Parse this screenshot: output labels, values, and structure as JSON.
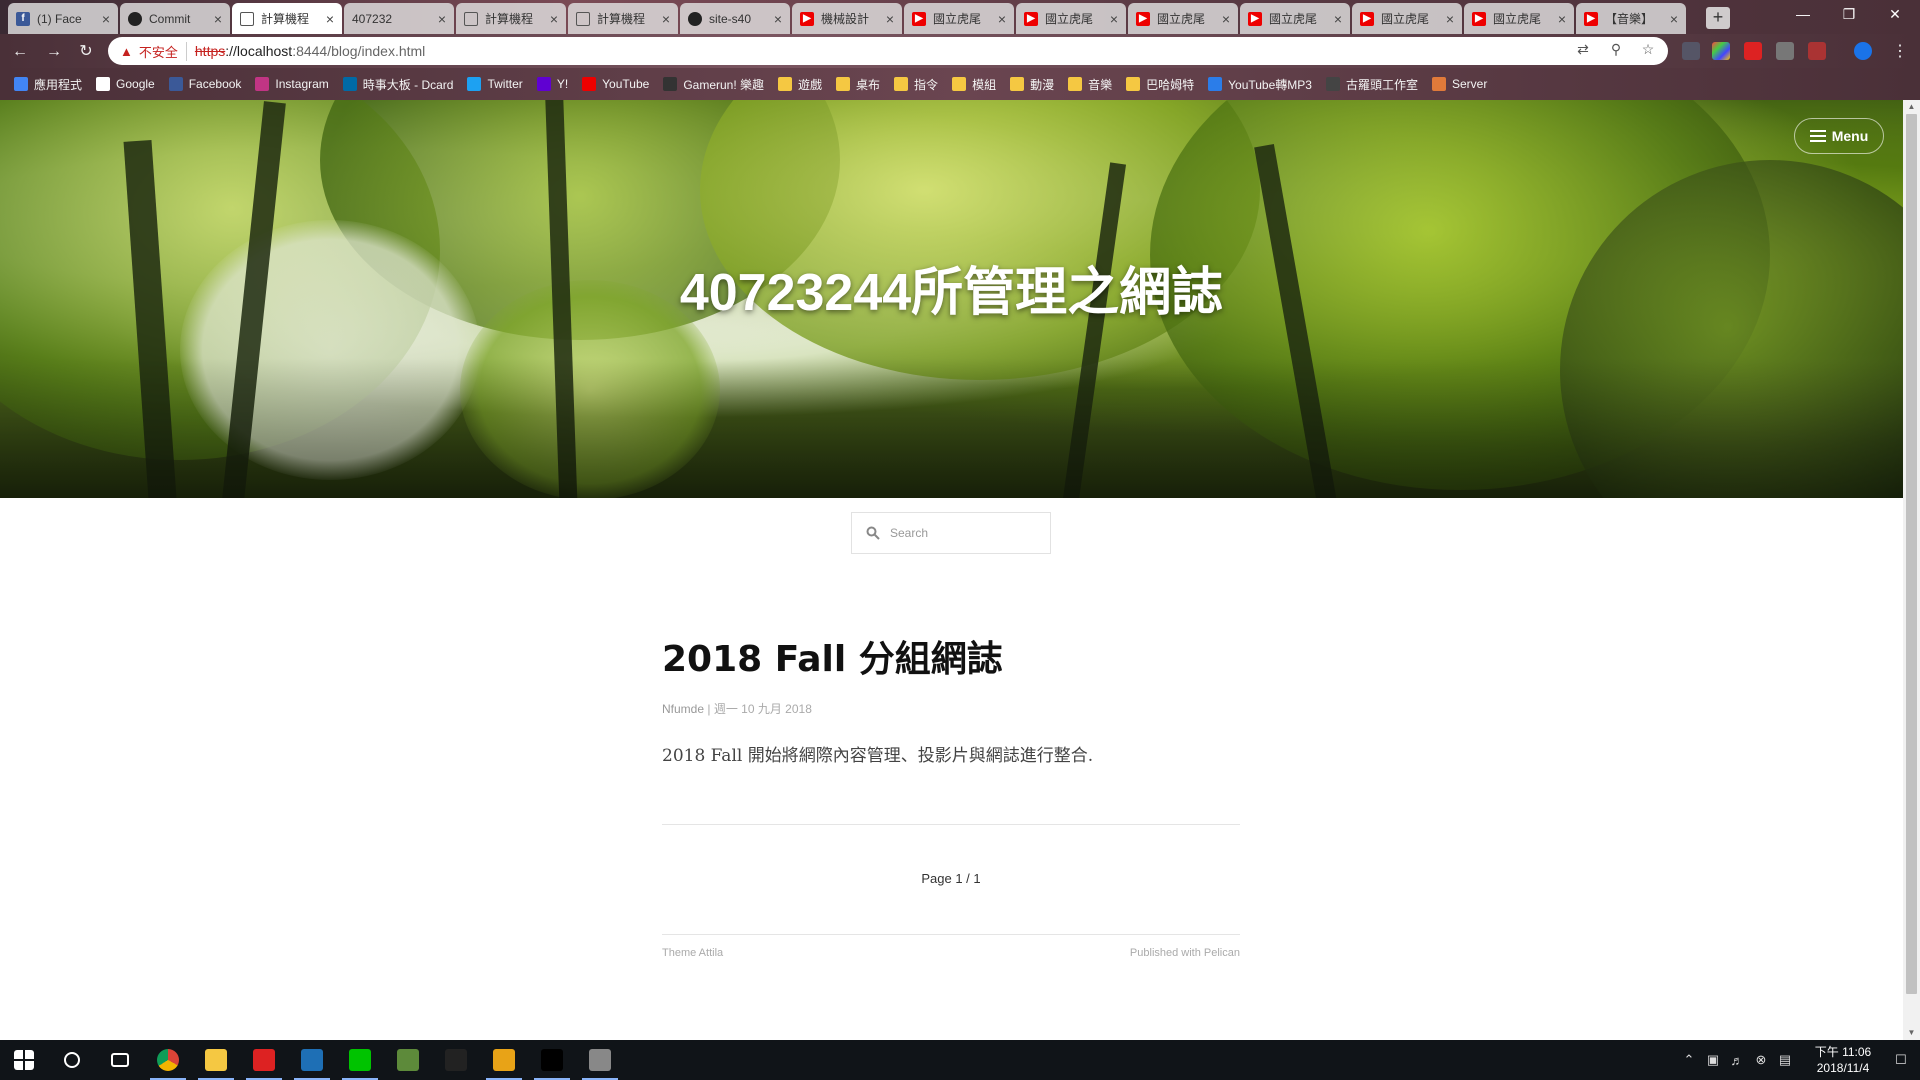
{
  "browser": {
    "tabs": [
      {
        "title": "(1) Face",
        "icon": "facebook-icon",
        "active": false
      },
      {
        "title": "Commit",
        "icon": "github-icon",
        "active": false
      },
      {
        "title": "計算機程",
        "icon": "document-icon",
        "active": true
      },
      {
        "title": "407232",
        "icon": "none",
        "active": false
      },
      {
        "title": "計算機程",
        "icon": "document-icon",
        "active": false
      },
      {
        "title": "計算機程",
        "icon": "document-icon",
        "active": false
      },
      {
        "title": "site-s40",
        "icon": "github-icon",
        "active": false
      },
      {
        "title": "機械設計",
        "icon": "youtube-icon",
        "active": false
      },
      {
        "title": "國立虎尾",
        "icon": "youtube-icon",
        "active": false
      },
      {
        "title": "國立虎尾",
        "icon": "youtube-icon",
        "active": false
      },
      {
        "title": "國立虎尾",
        "icon": "youtube-icon",
        "active": false
      },
      {
        "title": "國立虎尾",
        "icon": "youtube-icon",
        "active": false
      },
      {
        "title": "國立虎尾",
        "icon": "youtube-icon",
        "active": false
      },
      {
        "title": "國立虎尾",
        "icon": "youtube-icon",
        "active": false
      },
      {
        "title": "【音樂】",
        "icon": "youtube-icon",
        "active": false
      }
    ],
    "security_label": "不安全",
    "url_scheme": "https",
    "url_host": "://localhost",
    "url_rest": ":8444/blog/index.html",
    "bookmarks": [
      {
        "label": "應用程式",
        "icon": "apps-icon"
      },
      {
        "label": "Google",
        "icon": "google-icon"
      },
      {
        "label": "Facebook",
        "icon": "facebook-icon"
      },
      {
        "label": "Instagram",
        "icon": "instagram-icon"
      },
      {
        "label": "時事大板 - Dcard",
        "icon": "dcard-icon"
      },
      {
        "label": "Twitter",
        "icon": "twitter-icon"
      },
      {
        "label": "Y!",
        "icon": "yahoo-icon"
      },
      {
        "label": "YouTube",
        "icon": "youtube-icon"
      },
      {
        "label": "Gamerun! 樂趣",
        "icon": "gamer-icon"
      },
      {
        "label": "遊戲",
        "icon": "folder-icon"
      },
      {
        "label": "桌布",
        "icon": "folder-icon"
      },
      {
        "label": "指令",
        "icon": "folder-icon"
      },
      {
        "label": "模組",
        "icon": "folder-icon"
      },
      {
        "label": "動漫",
        "icon": "folder-icon"
      },
      {
        "label": "音樂",
        "icon": "folder-icon"
      },
      {
        "label": "巴哈姆特",
        "icon": "folder-icon"
      },
      {
        "label": "YouTube轉MP3",
        "icon": "mp3-icon"
      },
      {
        "label": "古羅頭工作室",
        "icon": "tool-icon"
      },
      {
        "label": "Server",
        "icon": "server-icon"
      }
    ]
  },
  "page": {
    "menu_label": "Menu",
    "site_title": "40723244所管理之網誌",
    "search_placeholder": "Search",
    "post": {
      "title": "2018 Fall 分組網誌",
      "author": "Nfumde",
      "separator": " | ",
      "date": "週一 10 九月 2018",
      "summary": "2018 Fall 開始將網際內容管理、投影片與網誌進行整合."
    },
    "pager": "Page 1 / 1",
    "footer_theme": "Theme Attila",
    "footer_published": "Published with Pelican"
  },
  "taskbar": {
    "apps": [
      "start-icon",
      "search-icon",
      "task-view-icon",
      "chrome-icon",
      "file-explorer-icon",
      "garena-icon",
      "inventor-icon",
      "line-icon",
      "minecraft-icon",
      "nox-icon",
      "autodesk-icon",
      "cmd-icon",
      "app-icon"
    ],
    "time": "下午 11:06",
    "date": "2018/11/4"
  },
  "colors": {
    "insecure": "#c5221f",
    "taskbar": "#101418",
    "hero_green": "#6f8f26"
  }
}
